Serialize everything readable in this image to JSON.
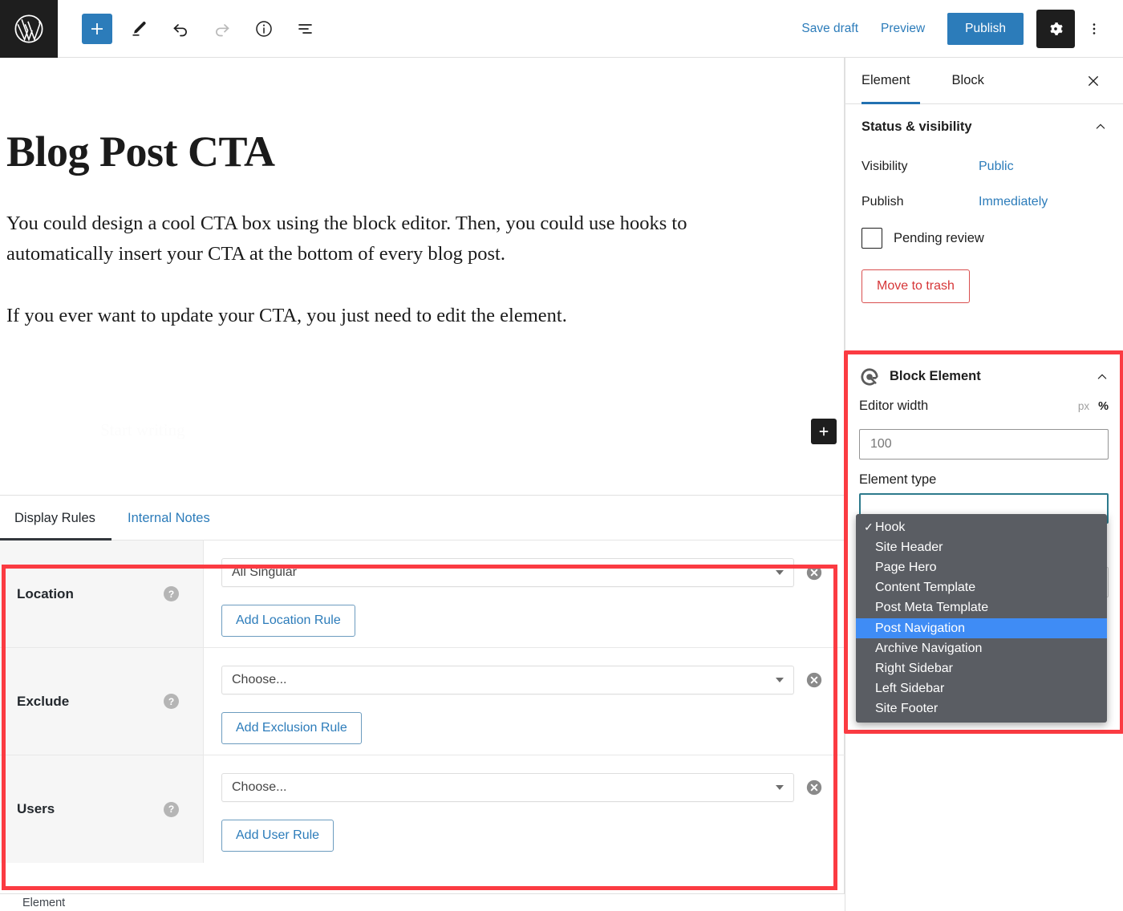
{
  "topbar": {
    "logo_icon": "wordpress-logo-icon",
    "tools": [
      {
        "name": "block-inserter-button",
        "icon": "plus-icon",
        "label": "Add block"
      },
      {
        "name": "tools-button",
        "icon": "pencil-icon",
        "label": "Tools"
      },
      {
        "name": "undo-button",
        "icon": "undo-arrow-icon",
        "label": "Undo"
      },
      {
        "name": "redo-button",
        "icon": "redo-arrow-icon",
        "label": "Redo"
      },
      {
        "name": "details-button",
        "icon": "info-circle-icon",
        "label": "Details"
      },
      {
        "name": "list-view-button",
        "icon": "list-view-icon",
        "label": "List view"
      }
    ],
    "save_draft_label": "Save draft",
    "preview_label": "Preview",
    "publish_label": "Publish",
    "settings_icon": "gear-icon",
    "more_icon": "three-dots-vertical-icon",
    "accent_blue": "#2c7cba",
    "dark": "#1e1e1e"
  },
  "editor": {
    "title": "Blog Post CTA",
    "paragraph_1": "You could design a cool CTA box using the block editor. Then, you could use hooks to automatically insert your CTA at the bottom of every blog post.",
    "paragraph_2": "If you ever want to update your CTA, you just need to edit the element.",
    "ghost_placeholder": "Start writing",
    "inserter_icon": "plus-icon"
  },
  "display_rules": {
    "tabs": [
      {
        "label": "Display Rules",
        "active": true
      },
      {
        "label": "Internal Notes",
        "active": false
      }
    ],
    "rows": [
      {
        "label": "Location",
        "help_icon": "question-mark-icon",
        "select_value": "All Singular",
        "remove_icon": "remove-circle-x-icon",
        "add_button_label": "Add Location Rule"
      },
      {
        "label": "Exclude",
        "help_icon": "question-mark-icon",
        "select_value": "Choose...",
        "remove_icon": "remove-circle-x-icon",
        "add_button_label": "Add Exclusion Rule"
      },
      {
        "label": "Users",
        "help_icon": "question-mark-icon",
        "select_value": "Choose...",
        "remove_icon": "remove-circle-x-icon",
        "add_button_label": "Add User Rule"
      }
    ],
    "highlight_color": "#fb3b42"
  },
  "statusbar": {
    "label": "Element"
  },
  "sidebar": {
    "tabs": [
      {
        "label": "Element",
        "active": true
      },
      {
        "label": "Block",
        "active": false
      }
    ],
    "close_icon": "close-x-icon",
    "status_visibility": {
      "title": "Status & visibility",
      "collapse_icon": "chevron-up-icon",
      "visibility_label": "Visibility",
      "visibility_value": "Public",
      "publish_label": "Publish",
      "publish_value": "Immediately",
      "pending_review_label": "Pending review",
      "pending_review_checked": false,
      "move_to_trash_label": "Move to trash",
      "trash_color": "#d63638"
    },
    "block_element": {
      "title": "Block Element",
      "panel_icon": "block-element-logo-icon",
      "collapse_icon": "chevron-up-icon",
      "editor_width_label": "Editor width",
      "unit_px": "px",
      "unit_percent": "%",
      "active_unit": "%",
      "editor_width_value": "100",
      "element_type_label": "Element type",
      "element_type_selected": "Hook",
      "options": [
        {
          "label": "Hook",
          "checked": true,
          "highlighted": false
        },
        {
          "label": "Site Header",
          "checked": false,
          "highlighted": false
        },
        {
          "label": "Page Hero",
          "checked": false,
          "highlighted": false
        },
        {
          "label": "Content Template",
          "checked": false,
          "highlighted": false
        },
        {
          "label": "Post Meta Template",
          "checked": false,
          "highlighted": false
        },
        {
          "label": "Post Navigation",
          "checked": false,
          "highlighted": true
        },
        {
          "label": "Archive Navigation",
          "checked": false,
          "highlighted": false
        },
        {
          "label": "Right Sidebar",
          "checked": false,
          "highlighted": false
        },
        {
          "label": "Left Sidebar",
          "checked": false,
          "highlighted": false
        },
        {
          "label": "Site Footer",
          "checked": false,
          "highlighted": false
        }
      ],
      "dropdown_bg": "#5a5d63",
      "dropdown_highlight": "#3f8cf5"
    }
  }
}
